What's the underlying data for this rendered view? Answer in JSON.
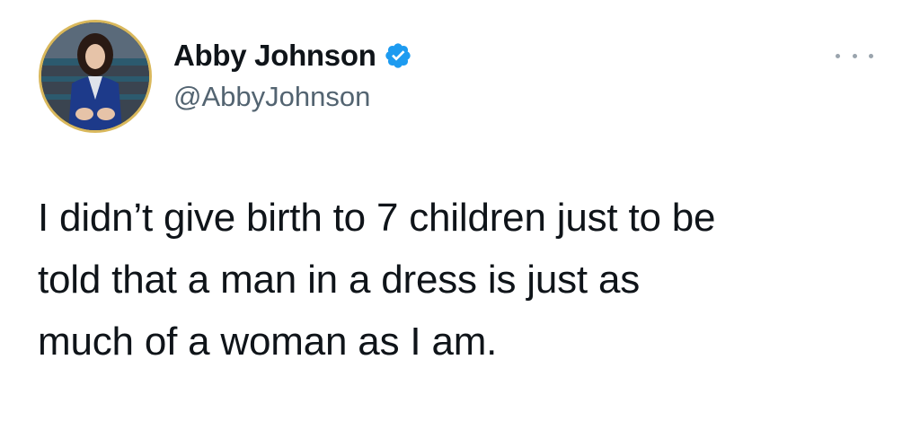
{
  "author": {
    "display_name": "Abby Johnson",
    "handle": "@AbbyJohnson",
    "verified_icon": "verified-badge-icon",
    "verified_color": "#1d9bf0"
  },
  "menu": {
    "more_icon": "more-options-icon"
  },
  "tweet": {
    "text_lines": [
      "I didn’t give birth to 7 children just to be",
      "told that a man in a dress is just as",
      "much of a woman as I am."
    ]
  }
}
